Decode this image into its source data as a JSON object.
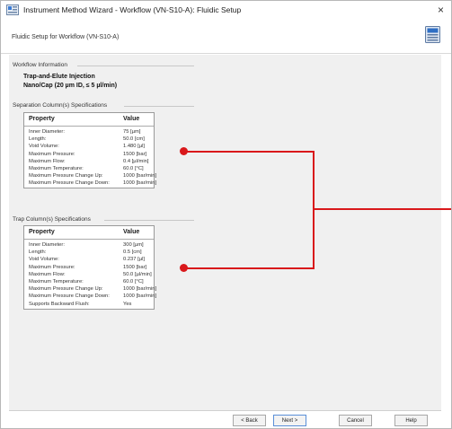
{
  "window": {
    "title": "Instrument Method Wizard - Workflow (VN-S10-A): Fluidic Setup",
    "close_glyph": "×"
  },
  "header": {
    "text": "Fluidic Setup for Workflow (VN-S10-A)",
    "icon": "instrument-icon"
  },
  "workflow_group": {
    "title": "Workflow Information",
    "name_line1": "Trap-and-Elute Injection",
    "name_line2": "Nano/Cap (20 µm ID, ≤ 5 µl/min)"
  },
  "separation_group": {
    "title": "Separation Column(s) Specifications",
    "header_property": "Property",
    "header_value": "Value",
    "rows": [
      {
        "property": "Inner Diameter:",
        "value": "75 [µm]"
      },
      {
        "property": "Length:",
        "value": "50.0 [cm]"
      },
      {
        "property": "Void Volume:",
        "value": "1.480 [µl]"
      },
      {
        "property": "Maximum Pressure:",
        "value": "1500 [bar]"
      },
      {
        "property": "Maximum Flow:",
        "value": "0.4 [µl/min]"
      },
      {
        "property": "Maximum Temperature:",
        "value": "60.0 [°C]"
      },
      {
        "property": "Maximum Pressure Change Up:",
        "value": "1000 [bar/min]"
      },
      {
        "property": "Maximum Pressure Change Down:",
        "value": "1000 [bar/min]"
      }
    ]
  },
  "trap_group": {
    "title": "Trap Column(s) Specifications",
    "header_property": "Property",
    "header_value": "Value",
    "rows": [
      {
        "property": "Inner Diameter:",
        "value": "300 [µm]"
      },
      {
        "property": "Length:",
        "value": "0.5 [cm]"
      },
      {
        "property": "Void Volume:",
        "value": "0.237 [µl]"
      },
      {
        "property": "Maximum Pressure:",
        "value": "1500 [bar]"
      },
      {
        "property": "Maximum Flow:",
        "value": "50.0 [µl/min]"
      },
      {
        "property": "Maximum Temperature:",
        "value": "60.0 [°C]"
      },
      {
        "property": "Maximum Pressure Change Up:",
        "value": "1000 [bar/min]"
      },
      {
        "property": "Maximum Pressure Change Down:",
        "value": "1000 [bar/min]"
      },
      {
        "property": "Supports Backward Flush:",
        "value": "Yes"
      }
    ]
  },
  "buttons": {
    "back": "< Back",
    "next": "Next >",
    "cancel": "Cancel",
    "help": "Help"
  },
  "colors": {
    "callout": "#d9181b"
  }
}
